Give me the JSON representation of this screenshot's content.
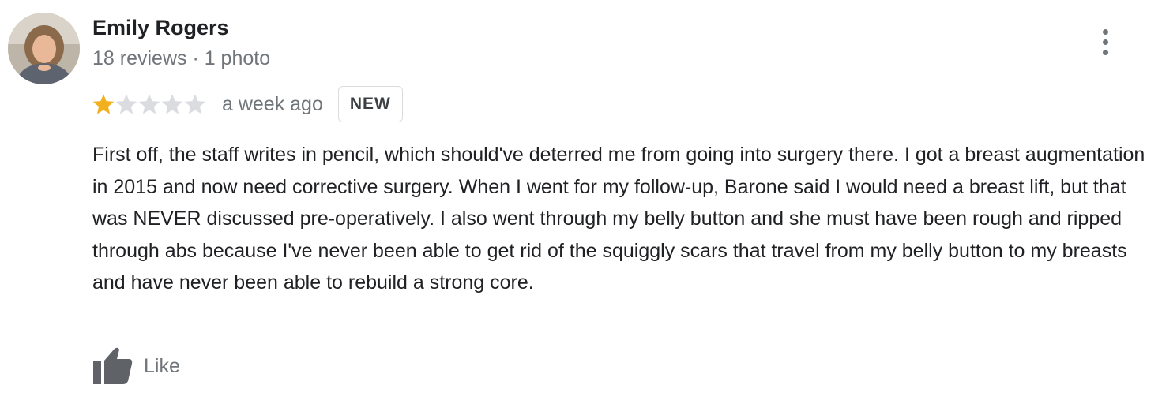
{
  "reviewer": {
    "name": "Emily Rogers",
    "meta": "18 reviews · 1 photo",
    "avatar_icon": "profile-photo"
  },
  "menu": {
    "icon": "more-vert-icon"
  },
  "rating": {
    "stars_filled": 1,
    "stars_total": 5,
    "filled_color": "#f2b01e",
    "empty_color": "#dadce0",
    "time_ago": "a week ago",
    "badge": "NEW"
  },
  "review": {
    "text": "First off, the staff writes in pencil, which should've deterred me from going into surgery there. I got a breast augmentation in 2015 and now need corrective surgery. When I went for my follow-up, Barone said I would need a breast lift, but that was NEVER discussed pre-operatively. I also went through my belly button and she must have been rough and ripped through abs because I've never been able to get rid of the squiggly scars that travel from my belly button to my breasts and have never been able to rebuild a strong core."
  },
  "actions": {
    "like_label": "Like",
    "like_icon": "thumbs-up-icon",
    "icon_color": "#5f6368"
  }
}
